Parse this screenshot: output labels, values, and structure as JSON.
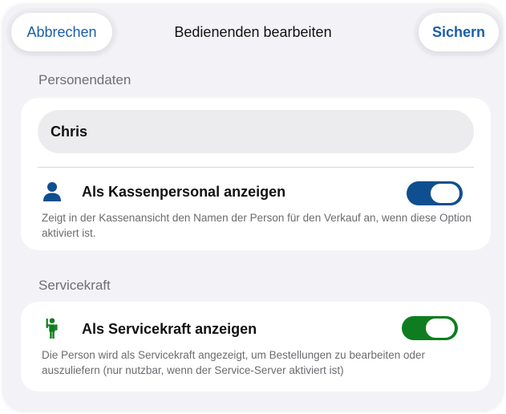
{
  "header": {
    "cancel_label": "Abbrechen",
    "title": "Bedienenden bearbeiten",
    "save_label": "Sichern"
  },
  "personal": {
    "section_title": "Personendaten",
    "name_value": "Chris",
    "toggle_label": "Als Kassenpersonal anzeigen",
    "toggle_on": true,
    "description": "Zeigt in der Kassenansicht den Namen der Person für den Verkauf an, wenn diese Option aktiviert ist.",
    "icon": "person-icon",
    "accent": "#0f4f8f"
  },
  "service": {
    "section_title": "Servicekraft",
    "toggle_label": "Als Servicekraft anzeigen",
    "toggle_on": true,
    "description": "Die Person wird als Servicekraft angezeigt, um Bestellungen zu bearbeiten oder auszuliefern (nur nutzbar, wenn der Service-Server aktiviert ist)",
    "icon": "waiter-icon",
    "accent": "#0f7d1f"
  }
}
